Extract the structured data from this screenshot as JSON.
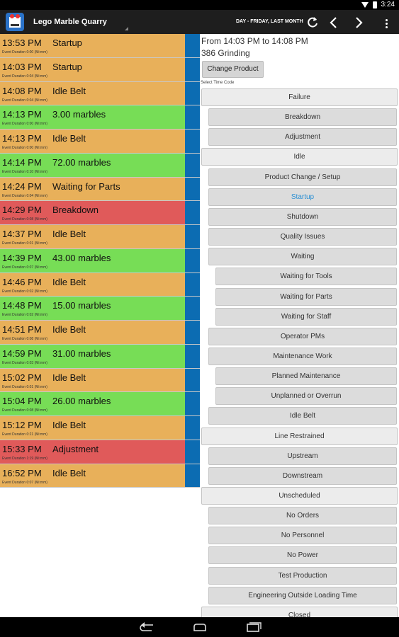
{
  "status_bar": {
    "time": "3:24"
  },
  "action_bar": {
    "title": "Lego Marble Quarry",
    "date_range": "DAY - FRIDAY, LAST MONTH"
  },
  "events": [
    {
      "time": "13:53 PM",
      "label": "Startup",
      "duration": "Event Duration 0:00 (Mi:mm)",
      "status": "orange"
    },
    {
      "time": "14:03 PM",
      "label": "Startup",
      "duration": "Event Duration 0:04 (Mi:mm)",
      "status": "orange"
    },
    {
      "time": "14:08 PM",
      "label": "Idle Belt",
      "duration": "Event Duration 0:04 (Mi:mm)",
      "status": "orange"
    },
    {
      "time": "14:13 PM",
      "label": "3.00 marbles",
      "duration": "Event Duration 0:00 (Mi:mm)",
      "status": "green"
    },
    {
      "time": "14:13 PM",
      "label": "Idle Belt",
      "duration": "Event Duration 0:00 (Mi:mm)",
      "status": "orange"
    },
    {
      "time": "14:14 PM",
      "label": "72.00 marbles",
      "duration": "Event Duration 0:10 (Mi:mm)",
      "status": "green"
    },
    {
      "time": "14:24 PM",
      "label": "Waiting for Parts",
      "duration": "Event Duration 0:04 (Mi:mm)",
      "status": "orange"
    },
    {
      "time": "14:29 PM",
      "label": "Breakdown",
      "duration": "Event Duration 0:08 (Mi:mm)",
      "status": "red"
    },
    {
      "time": "14:37 PM",
      "label": "Idle Belt",
      "duration": "Event Duration 0:01 (Mi:mm)",
      "status": "orange"
    },
    {
      "time": "14:39 PM",
      "label": "43.00 marbles",
      "duration": "Event Duration 0:07 (Mi:mm)",
      "status": "green"
    },
    {
      "time": "14:46 PM",
      "label": "Idle Belt",
      "duration": "Event Duration 0:02 (Mi:mm)",
      "status": "orange"
    },
    {
      "time": "14:48 PM",
      "label": "15.00 marbles",
      "duration": "Event Duration 0:02 (Mi:mm)",
      "status": "green"
    },
    {
      "time": "14:51 PM",
      "label": "Idle Belt",
      "duration": "Event Duration 0:08 (Mi:mm)",
      "status": "orange"
    },
    {
      "time": "14:59 PM",
      "label": "31.00 marbles",
      "duration": "Event Duration 0:03 (Mi:mm)",
      "status": "green"
    },
    {
      "time": "15:02 PM",
      "label": "Idle Belt",
      "duration": "Event Duration 0:01 (Mi:mm)",
      "status": "orange"
    },
    {
      "time": "15:04 PM",
      "label": "26.00 marbles",
      "duration": "Event Duration 0:08 (Mi:mm)",
      "status": "green"
    },
    {
      "time": "15:12 PM",
      "label": "Idle Belt",
      "duration": "Event Duration 0:21 (Mi:mm)",
      "status": "orange"
    },
    {
      "time": "15:33 PM",
      "label": "Adjustment",
      "duration": "Event Duration 1:19 (Mi:mm)",
      "status": "red"
    },
    {
      "time": "16:52 PM",
      "label": "Idle Belt",
      "duration": "Event Duration 0:07 (Mi:mm)",
      "status": "orange"
    }
  ],
  "detail": {
    "range": "From 14:03 PM to 14:08 PM",
    "product": "386 Grinding",
    "change_product_label": "Change Product",
    "select_time_code_label": "Select Time Code"
  },
  "time_codes": [
    {
      "label": "Failure",
      "level": 0
    },
    {
      "label": "Breakdown",
      "level": 1
    },
    {
      "label": "Adjustment",
      "level": 1
    },
    {
      "label": "Idle",
      "level": 0
    },
    {
      "label": "Product Change / Setup",
      "level": 1
    },
    {
      "label": "Startup",
      "level": 1,
      "selected": true
    },
    {
      "label": "Shutdown",
      "level": 1
    },
    {
      "label": "Quality Issues",
      "level": 1
    },
    {
      "label": "Waiting",
      "level": 1
    },
    {
      "label": "Waiting for Tools",
      "level": 2
    },
    {
      "label": "Waiting for Parts",
      "level": 2
    },
    {
      "label": "Waiting for Staff",
      "level": 2
    },
    {
      "label": "Operator PMs",
      "level": 1
    },
    {
      "label": "Maintenance Work",
      "level": 1
    },
    {
      "label": "Planned Maintenance",
      "level": 2
    },
    {
      "label": "Unplanned or Overrun",
      "level": 2
    },
    {
      "label": "Idle Belt",
      "level": 1
    },
    {
      "label": "Line Restrained",
      "level": 0
    },
    {
      "label": "Upstream",
      "level": 1
    },
    {
      "label": "Downstream",
      "level": 1
    },
    {
      "label": "Unscheduled",
      "level": 0
    },
    {
      "label": "No Orders",
      "level": 1
    },
    {
      "label": "No Personnel",
      "level": 1
    },
    {
      "label": "No Power",
      "level": 1
    },
    {
      "label": "Test Production",
      "level": 1
    },
    {
      "label": "Engineering Outside Loading Time",
      "level": 1
    },
    {
      "label": "Closed",
      "level": 0
    }
  ],
  "colors": {
    "orange": "#e8b05a",
    "green": "#77dd56",
    "red": "#e05a5a",
    "blue": "#0c6cb2",
    "selected_text": "#2a8fd3"
  },
  "icons": {
    "refresh": "refresh-icon",
    "prev": "chevron-left-icon",
    "next": "chevron-right-icon",
    "menu": "overflow-menu-icon",
    "back": "back-icon",
    "home": "home-icon",
    "recents": "recents-icon"
  }
}
